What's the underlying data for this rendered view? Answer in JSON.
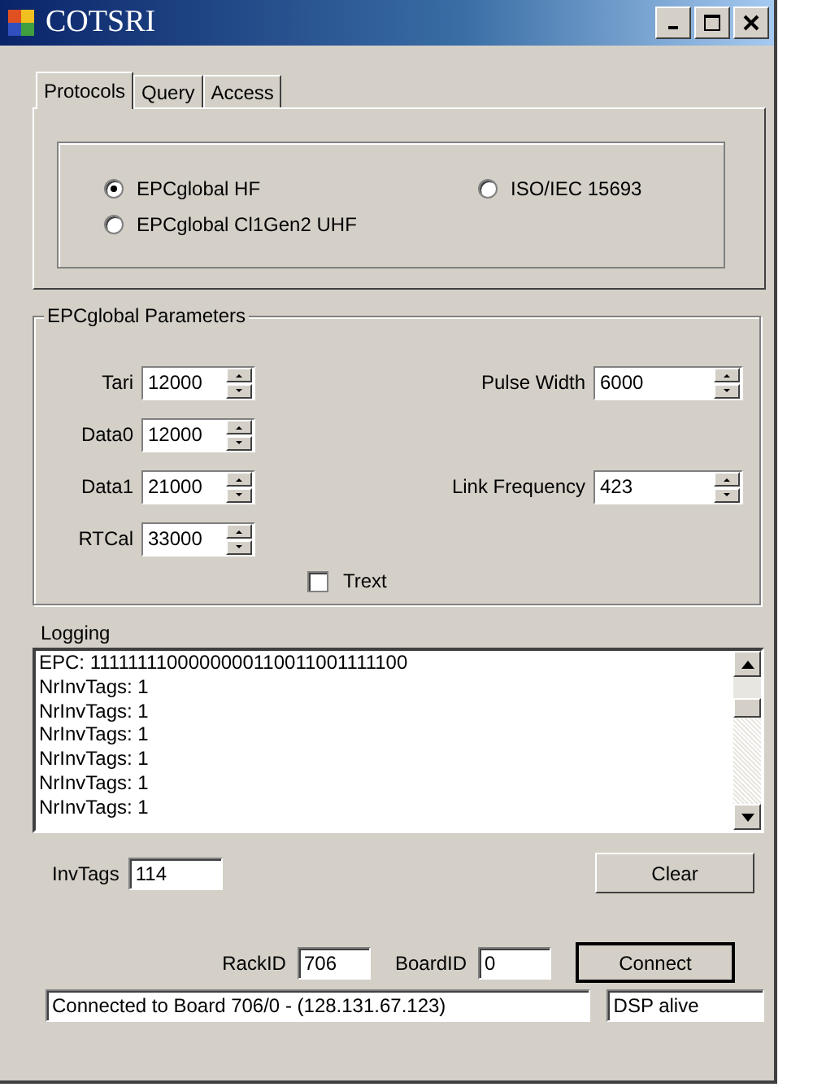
{
  "window": {
    "title": "COTSRI"
  },
  "tabs": [
    {
      "label": "Protocols",
      "selected": true
    },
    {
      "label": "Query",
      "selected": false
    },
    {
      "label": "Access",
      "selected": false
    }
  ],
  "protocols": [
    {
      "label": "EPCglobal HF",
      "selected": true
    },
    {
      "label": "ISO/IEC 15693",
      "selected": false
    },
    {
      "label": "EPCglobal Cl1Gen2 UHF",
      "selected": false
    }
  ],
  "parameters": {
    "title": "EPCglobal Parameters",
    "rows": [
      {
        "left": {
          "label": "Tari",
          "value": "12000"
        },
        "right": {
          "label": "Pulse Width",
          "value": "6000"
        }
      },
      {
        "left": {
          "label": "Data0",
          "value": "12000"
        }
      },
      {
        "left": {
          "label": "Data1",
          "value": "21000"
        },
        "right": {
          "label": "Link Frequency",
          "value": "423"
        }
      },
      {
        "left": {
          "label": "RTCal",
          "value": "33000"
        }
      }
    ],
    "trext": {
      "label": "Trext",
      "checked": false
    }
  },
  "logging": {
    "title": "Logging",
    "lines": [
      "EPC: 1111111100000000110011001111100",
      "NrInvTags: 1",
      "NrInvTags: 1",
      "NrInvTags: 1",
      "NrInvTags: 1",
      "NrInvTags: 1",
      "NrInvTags: 1"
    ]
  },
  "inv_tags": {
    "label": "InvTags",
    "value": "114"
  },
  "clear_button": "Clear",
  "rack_id": {
    "label": "RackID",
    "value": "706"
  },
  "board_id": {
    "label": "BoardID",
    "value": "0"
  },
  "connect_button": "Connect",
  "status": {
    "message": "Connected to Board 706/0 - (128.131.67.123)",
    "dsp": "DSP alive"
  }
}
